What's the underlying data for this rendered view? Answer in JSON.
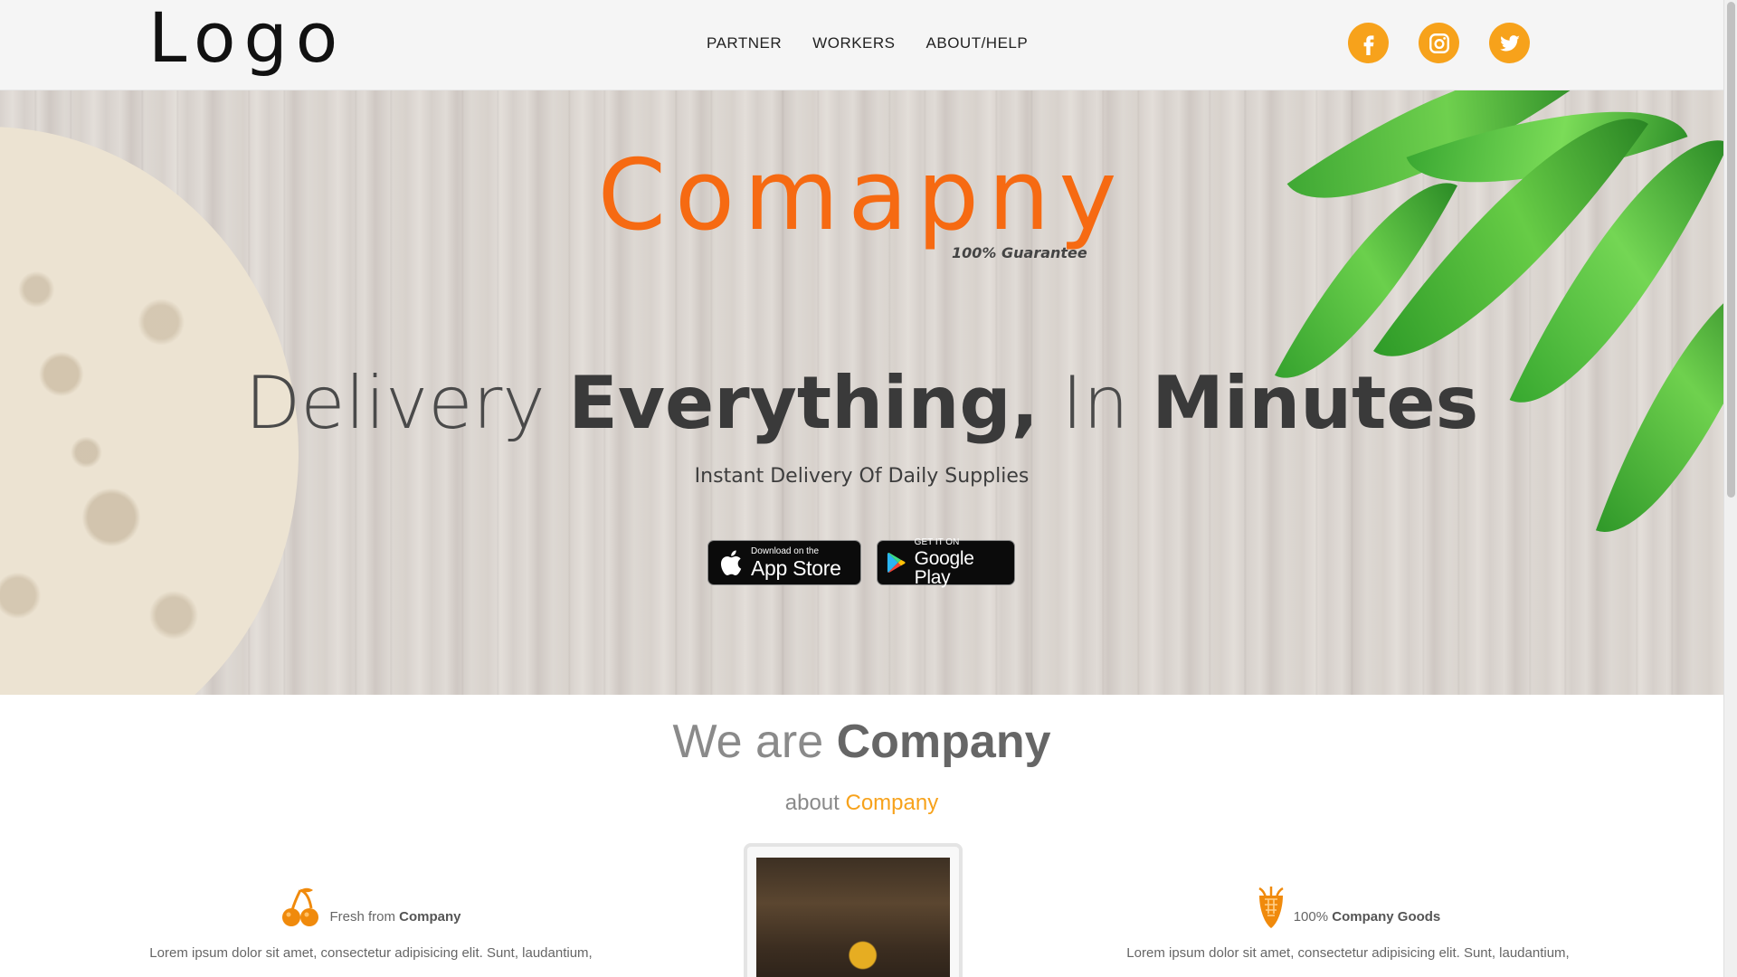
{
  "header": {
    "logo": "Logo",
    "nav": [
      "PARTNER",
      "WORKERS",
      "ABOUT/HELP"
    ],
    "social": [
      "facebook-icon",
      "instagram-icon",
      "twitter-icon"
    ],
    "accent_color": "#f7a21b"
  },
  "hero": {
    "brand": "Comapny",
    "brand_color": "#f66a12",
    "guarantee": "100% Guarantee",
    "headline": {
      "part1": "Delivery ",
      "part2": "Everything,",
      "part3": " In ",
      "part4": "Minutes"
    },
    "subtitle": "Instant Delivery Of Daily Supplies",
    "app_store": {
      "small": "Download on the",
      "big": "App Store"
    },
    "google_play": {
      "small": "GET IT ON",
      "big": "Google Play"
    }
  },
  "about": {
    "title_light": "We are ",
    "title_bold": "Company",
    "sub_light": "about ",
    "sub_accent": "Company",
    "features": [
      {
        "icon": "cherry-icon",
        "title_light": "Fresh from ",
        "title_bold": "Company",
        "desc": "Lorem ipsum dolor sit amet, consectetur adipisicing elit. Sunt, laudantium,"
      },
      {
        "icon": "corn-icon",
        "title_light": "100% ",
        "title_bold": "Company Goods",
        "desc": "Lorem ipsum dolor sit amet, consectetur adipisicing elit. Sunt, laudantium,"
      }
    ]
  }
}
